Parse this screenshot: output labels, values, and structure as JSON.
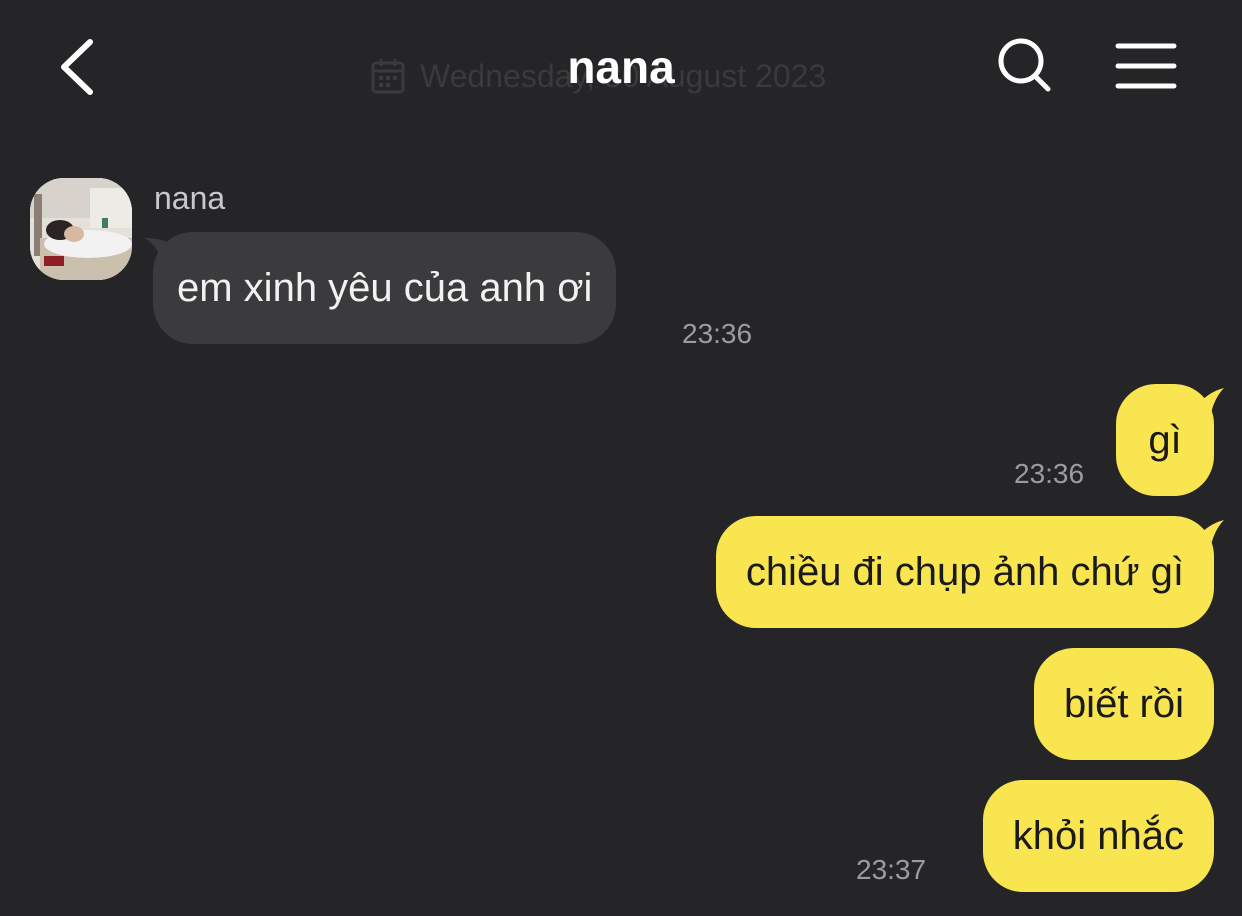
{
  "header": {
    "title": "nana",
    "date_text": "Wednesday, 30 August 2023"
  },
  "messages": [
    {
      "direction": "in",
      "sender": "nana",
      "text": "em xinh yêu của anh ơi",
      "time": "23:36"
    },
    {
      "direction": "out",
      "text": "gì",
      "time": "23:36"
    },
    {
      "direction": "out",
      "text": "chiều đi chụp ảnh chứ gì",
      "time": ""
    },
    {
      "direction": "out",
      "text": "biết rồi",
      "time": ""
    },
    {
      "direction": "out",
      "text": "khỏi nhắc",
      "time": "23:37"
    }
  ],
  "colors": {
    "background": "#252527",
    "bubble_in": "#3b3b3e",
    "bubble_out": "#f9e54f",
    "timestamp": "#9c9c9f"
  },
  "icons": [
    "back-chevron-icon",
    "calendar-icon",
    "search-icon",
    "menu-icon"
  ]
}
